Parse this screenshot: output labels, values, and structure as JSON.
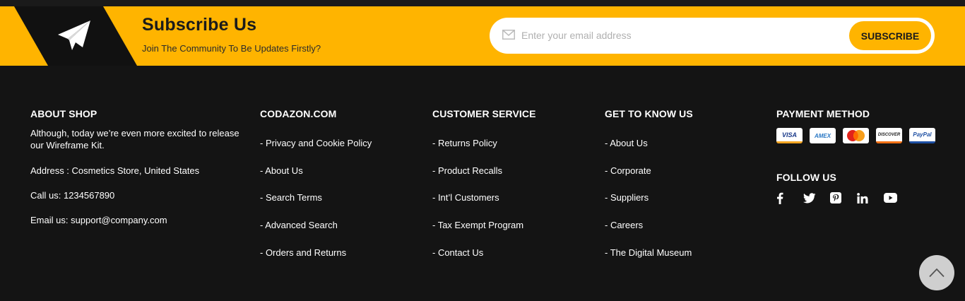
{
  "subscribe": {
    "title": "Subscribe Us",
    "description": "Join The Community To Be Updates Firstly?",
    "email_placeholder": "Enter your email address",
    "button_label": "SUBSCRIBE",
    "icon": "paper-plane-icon"
  },
  "about": {
    "heading": "ABOUT SHOP",
    "text": "Although, today we’re even more excited to release our Wireframe Kit.",
    "address": "Address : Cosmetics Store, United States",
    "phone": "Call us: 1234567890",
    "email": "Email us: support@company.com"
  },
  "codazon": {
    "heading": "CODAZON.COM",
    "links": [
      "- Privacy and Cookie Policy",
      "- About Us",
      "- Search Terms",
      "- Advanced Search",
      "- Orders and Returns"
    ]
  },
  "customer_service": {
    "heading": "CUSTOMER SERVICE",
    "links": [
      "- Returns Policy",
      "- Product Recalls",
      "- Int’l Customers",
      "- Tax Exempt Program",
      "- Contact Us"
    ]
  },
  "know_us": {
    "heading": "GET TO KNOW US",
    "links": [
      "- About Us",
      "- Corporate",
      "- Suppliers",
      "- Careers",
      "- The Digital Museum"
    ]
  },
  "payment": {
    "heading": "PAYMENT METHOD",
    "cards": [
      "VISA",
      "AMEX",
      "MasterCard",
      "DISCOVER",
      "PayPal"
    ]
  },
  "follow": {
    "heading": "FOLLOW US",
    "icons": [
      "facebook-icon",
      "twitter-icon",
      "pinterest-icon",
      "linkedin-icon",
      "youtube-icon"
    ]
  },
  "colors": {
    "accent": "#ffb400",
    "background": "#141414"
  }
}
